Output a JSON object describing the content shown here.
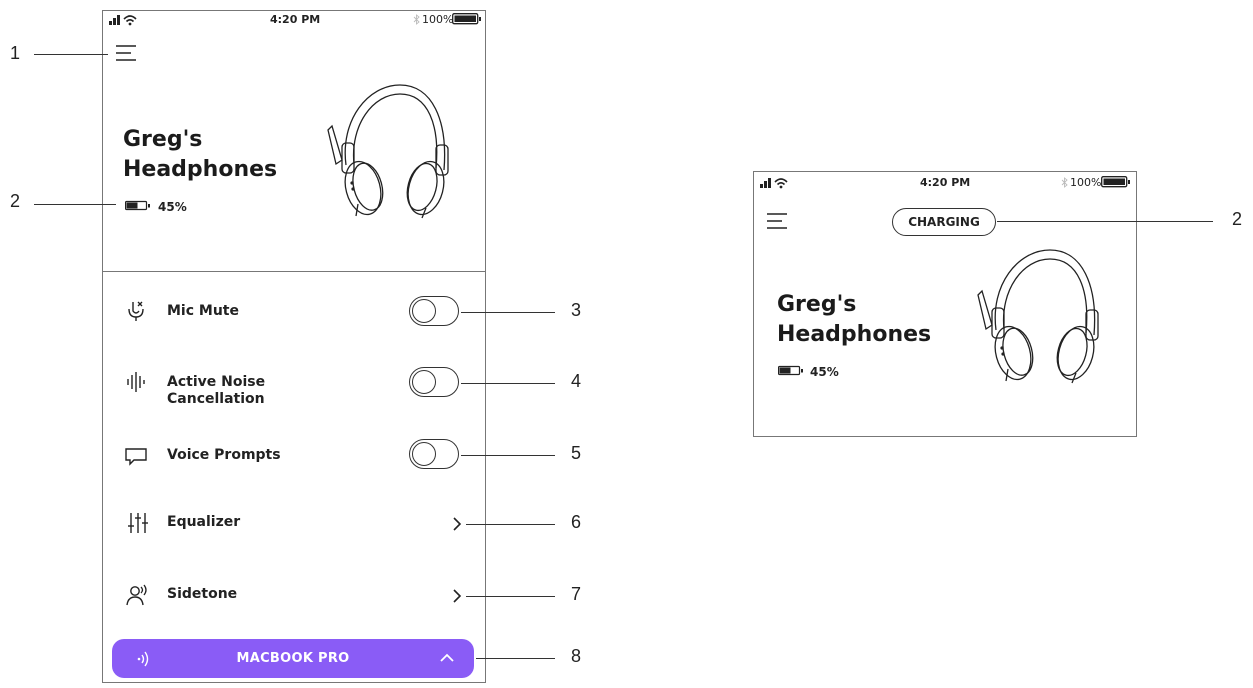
{
  "callouts": [
    "1",
    "2",
    "3",
    "4",
    "5",
    "6",
    "7",
    "8",
    "2"
  ],
  "main_screen": {
    "status_bar": {
      "time": "4:20 PM",
      "battery": "100%"
    },
    "device": {
      "name_line1": "Greg's",
      "name_line2": "Headphones",
      "battery": "45%"
    },
    "settings": [
      {
        "label": "Mic Mute",
        "icon": "mic-mute-icon",
        "control": "toggle",
        "on": false
      },
      {
        "label": "Active Noise",
        "label2": "Cancellation",
        "icon": "noise-cancellation-icon",
        "control": "toggle",
        "on": false
      },
      {
        "label": "Voice Prompts",
        "icon": "voice-prompts-icon",
        "control": "toggle",
        "on": false
      },
      {
        "label": "Equalizer",
        "icon": "equalizer-icon",
        "control": "chevron"
      },
      {
        "label": "Sidetone",
        "icon": "sidetone-icon",
        "control": "chevron"
      }
    ],
    "connected_device": {
      "label": "MACBOOK PRO",
      "color": "#8a5cf6"
    }
  },
  "charging_screen": {
    "status_bar": {
      "time": "4:20 PM",
      "battery": "100%"
    },
    "status_pill": "CHARGING",
    "device": {
      "name_line1": "Greg's",
      "name_line2": "Headphones",
      "battery": "45%"
    }
  }
}
